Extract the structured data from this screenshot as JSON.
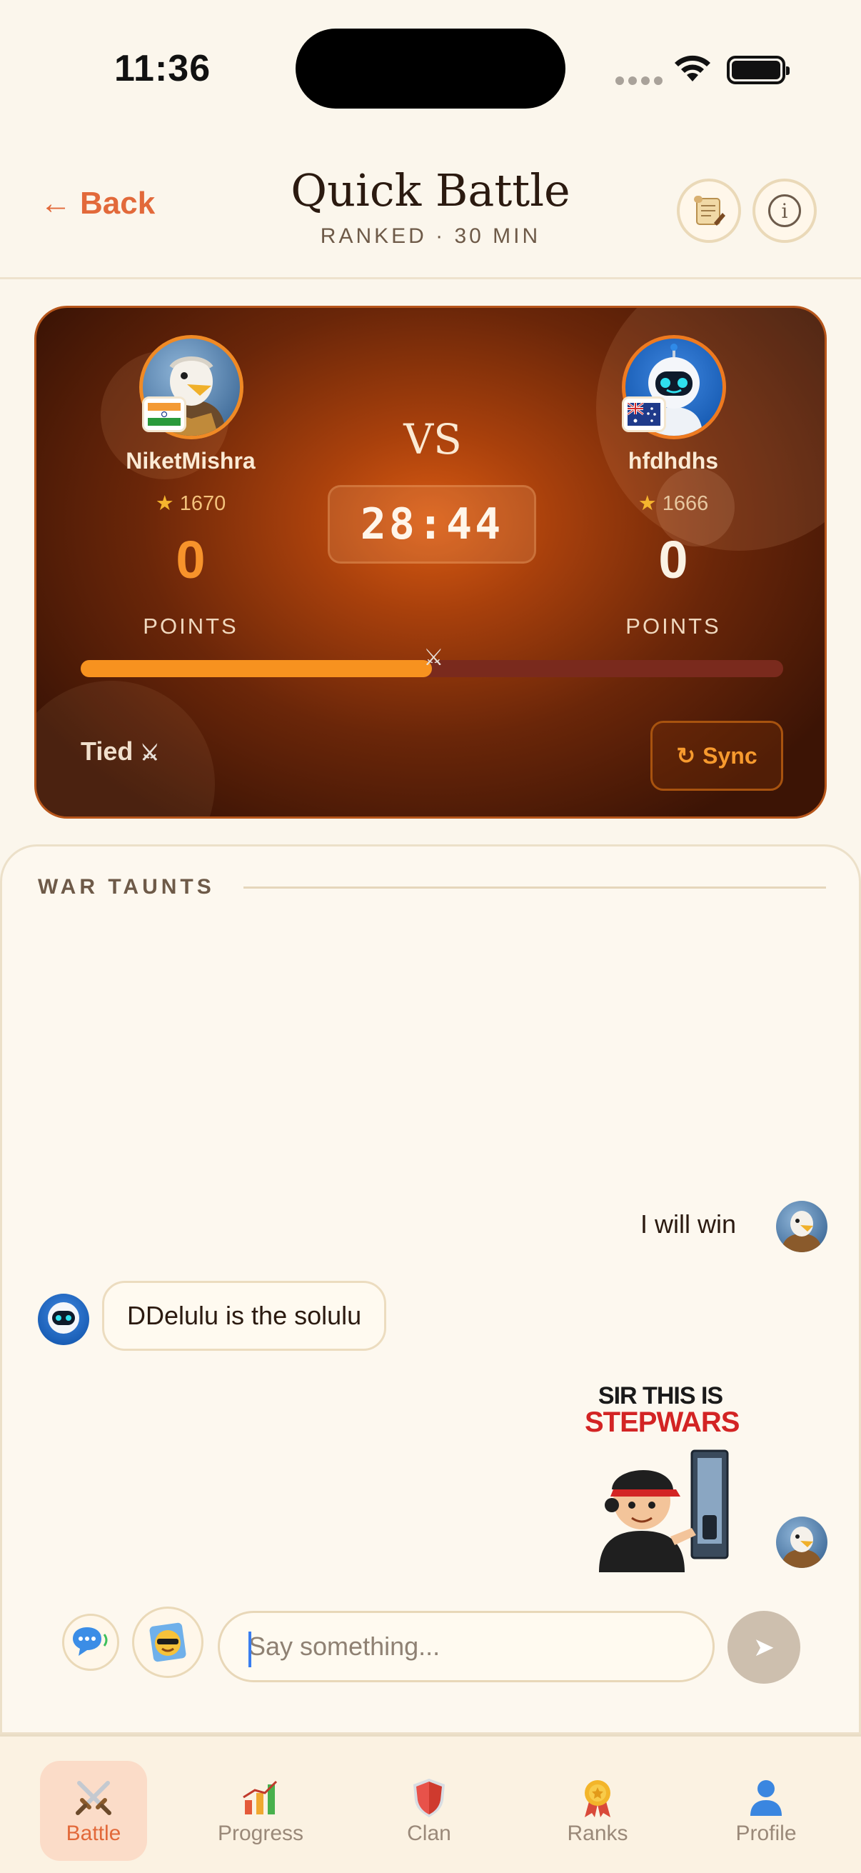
{
  "status": {
    "time": "11:36"
  },
  "header": {
    "back_label": "Back",
    "title": "Quick Battle",
    "subtitle": "RANKED · 30 MIN"
  },
  "battle": {
    "vs_label": "VS",
    "timer": "28:44",
    "player1": {
      "name": "NiketMishra",
      "rating": "1670",
      "score": "0",
      "points_label": "POINTS",
      "flag": "🇮🇳"
    },
    "player2": {
      "name": "hfdhdhs",
      "rating": "1666",
      "score": "0",
      "points_label": "POINTS",
      "flag": "🇦🇺"
    },
    "progress_fraction": 0.5,
    "status_label": "Tied",
    "sync_label": "Sync",
    "colors": {
      "accent": "#f7921f",
      "card_dark": "#3c1405"
    }
  },
  "chat": {
    "section_title": "WAR TAUNTS",
    "messages": [
      {
        "from": "me",
        "text": "I will win"
      },
      {
        "from": "opponent",
        "text": "DDelulu is the solulu"
      }
    ],
    "sticker": {
      "line1": "SIR THIS IS",
      "line2": "STEPWARS"
    },
    "input_placeholder": "Say something..."
  },
  "tabs": [
    {
      "label": "Battle",
      "icon": "crossed-swords-icon",
      "active": true
    },
    {
      "label": "Progress",
      "icon": "bar-chart-icon",
      "active": false
    },
    {
      "label": "Clan",
      "icon": "shield-icon",
      "active": false
    },
    {
      "label": "Ranks",
      "icon": "medal-icon",
      "active": false
    },
    {
      "label": "Profile",
      "icon": "person-icon",
      "active": false
    }
  ]
}
